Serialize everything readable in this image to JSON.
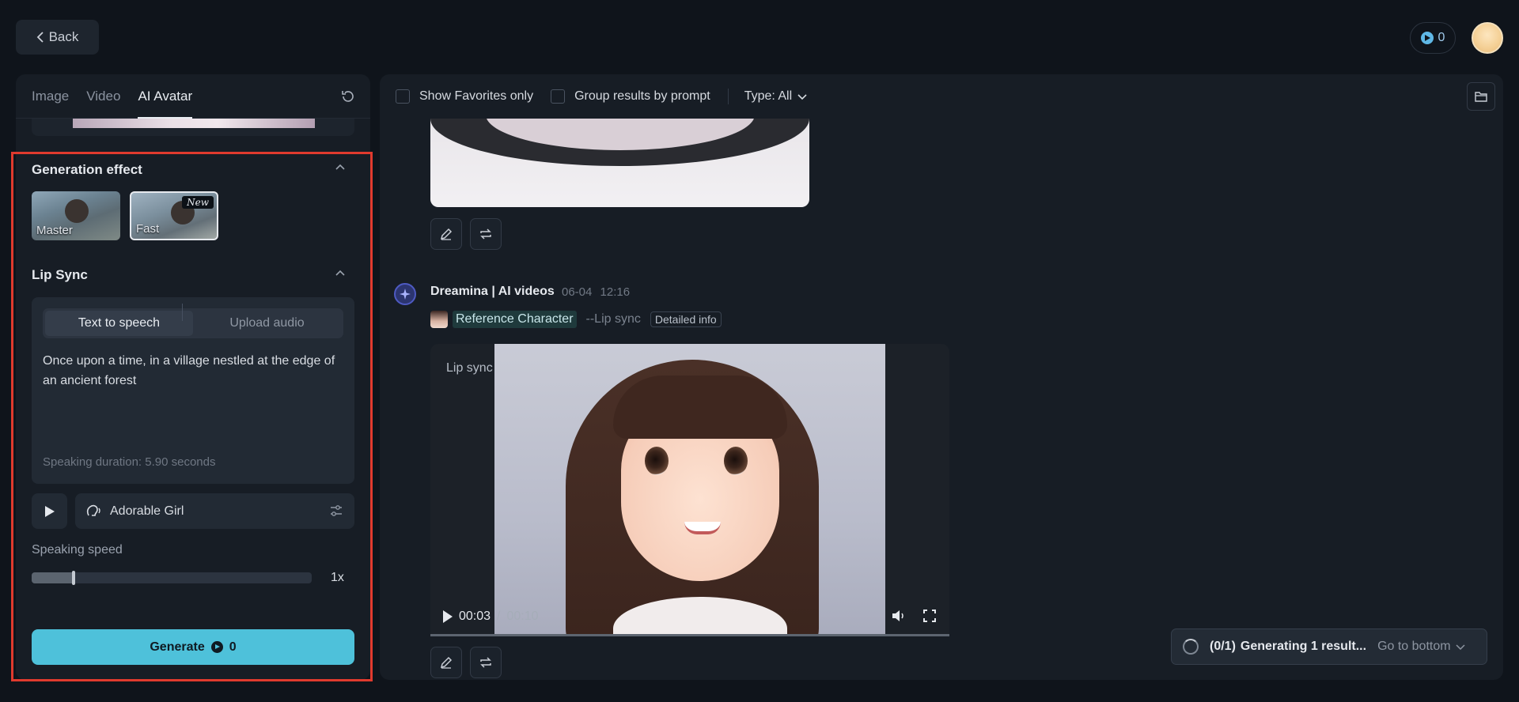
{
  "header": {
    "back_label": "Back",
    "credits": "0"
  },
  "left": {
    "tabs": [
      {
        "label": "Image"
      },
      {
        "label": "Video"
      },
      {
        "label": "AI Avatar"
      }
    ],
    "generation_effect": {
      "title": "Generation effect",
      "options": [
        {
          "label": "Master"
        },
        {
          "label": "Fast",
          "badge": "New",
          "selected": true
        }
      ]
    },
    "lip_sync": {
      "title": "Lip Sync",
      "modes": [
        "Text to speech",
        "Upload audio"
      ],
      "text": "Once upon a time, in a village nestled at the edge of an ancient forest",
      "duration": "Speaking duration: 5.90 seconds",
      "voice": "Adorable Girl"
    },
    "speaking_speed": {
      "label": "Speaking speed",
      "value": "1x",
      "level": 0.15
    },
    "generate": {
      "label": "Generate",
      "cost": "0"
    }
  },
  "right": {
    "filters": {
      "favorites": "Show Favorites only",
      "group": "Group results by prompt",
      "type": "Type: All"
    },
    "result": {
      "title": "Dreamina | AI videos",
      "date": "06-04",
      "time": "12:16",
      "reference": "Reference Character",
      "mode": "--Lip sync",
      "details": "Detailed info",
      "video_label": "Lip sync",
      "current": "00:03",
      "separator": "/",
      "total": "00:10"
    },
    "toast": {
      "count": "(0/1)",
      "message": "Generating 1 result...",
      "link": "Go to bottom"
    }
  },
  "colors": {
    "accent": "#4ec1da",
    "highlight_border": "#e03a2e"
  },
  "icons": [
    "chevron-left-icon",
    "coin-icon",
    "refresh-icon",
    "chevron-up-icon",
    "play-icon",
    "voice-icon",
    "sliders-icon",
    "folder-icon",
    "edit-icon",
    "repeat-icon",
    "star-logo-icon",
    "volume-icon",
    "fullscreen-icon",
    "spinner-icon",
    "chevron-down-icon"
  ]
}
